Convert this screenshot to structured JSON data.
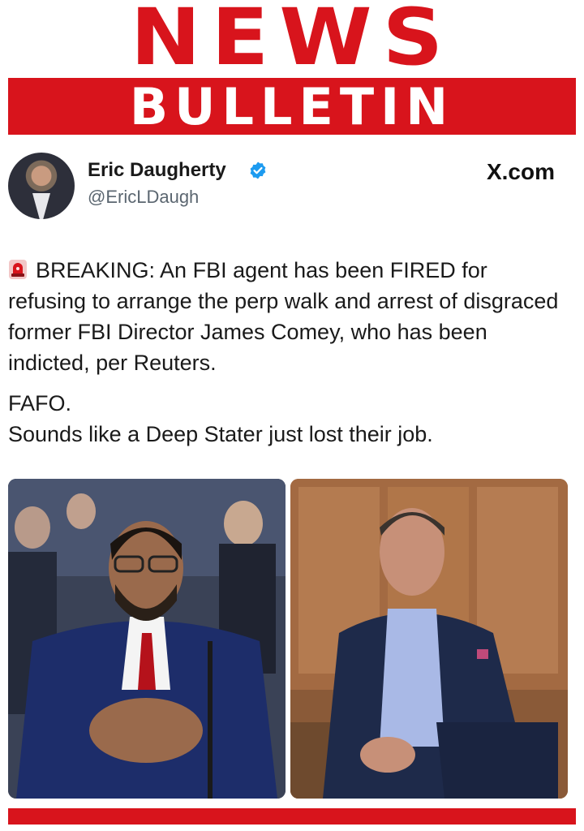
{
  "masthead": {
    "title": "NEWS",
    "subtitle": "BULLETIN"
  },
  "post": {
    "author_name": "Eric Daugherty",
    "author_handle": "@EricLDaugh",
    "source": "X.com",
    "verified": true,
    "paragraph1": "BREAKING: An FBI agent has been FIRED for refusing to arrange the perp walk and arrest of disgraced former FBI Director James Comey, who has been indicted, per Reuters.",
    "paragraph2_line1": "FAFO.",
    "paragraph2_line2": "Sounds like a Deep Stater just lost their job."
  },
  "icons": {
    "siren": "rotating-light-icon",
    "verified": "verified-badge-icon"
  },
  "colors": {
    "brand_red": "#d8141c",
    "verified_blue": "#1d9bf0",
    "handle_gray": "#5b6670"
  }
}
